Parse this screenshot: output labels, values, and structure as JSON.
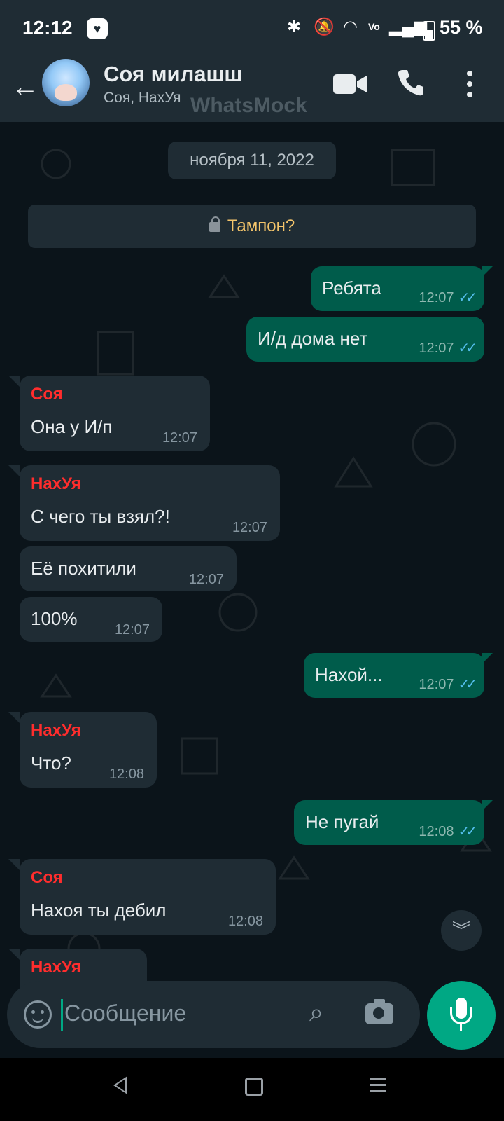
{
  "status_bar": {
    "time": "12:12",
    "battery": "55 %"
  },
  "header": {
    "title": "Соя милашш",
    "subtitle": "Соя, НахУя",
    "watermark": "WhatsMock"
  },
  "chat": {
    "date": "ноября 11, 2022",
    "encrypted_notice": "Тампон?",
    "messages": [
      {
        "dir": "out",
        "text": "Ребята",
        "time": "12:07"
      },
      {
        "dir": "out",
        "text": "И/д дома нет",
        "time": "12:07"
      },
      {
        "dir": "in",
        "sender": "Соя",
        "text": "Она у И/п",
        "time": "12:07"
      },
      {
        "dir": "in",
        "sender": "НахУя",
        "text": "С чего ты взял?!",
        "time": "12:07"
      },
      {
        "dir": "in",
        "text": "Её похитили",
        "time": "12:07"
      },
      {
        "dir": "in",
        "text": "100%",
        "time": "12:07"
      },
      {
        "dir": "out",
        "text": "Нахой...",
        "time": "12:07"
      },
      {
        "dir": "in",
        "sender": "НахУя",
        "text": "Что?",
        "time": "12:08"
      },
      {
        "dir": "out",
        "text": "Не пугай",
        "time": "12:08"
      },
      {
        "dir": "in",
        "sender": "Соя",
        "text": "Нахоя ты дебил",
        "time": "12:08"
      },
      {
        "dir": "in",
        "sender": "НахУя",
        "text": "",
        "time": ""
      }
    ]
  },
  "input": {
    "placeholder": "Сообщение"
  },
  "colors": {
    "outgoing": "#005c4b",
    "incoming": "#1f2c34",
    "accent": "#00a884",
    "sender_name": "#ff2d2d"
  },
  "icons": [
    "back-arrow-icon",
    "video-call-icon",
    "phone-call-icon",
    "more-options-icon",
    "lock-icon",
    "emoji-icon",
    "attach-icon",
    "camera-icon",
    "mic-icon",
    "scroll-down-icon"
  ]
}
